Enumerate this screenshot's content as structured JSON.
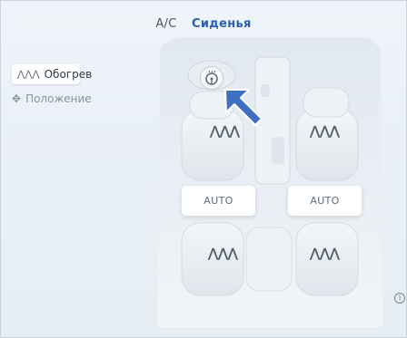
{
  "tabs": {
    "ac": "A/C",
    "seats": "Сиденья"
  },
  "menu": {
    "heating": "Обогрев",
    "position": "Положение"
  },
  "seats": {
    "front_left_heat_icon": "ꔷ",
    "auto_left": "AUTO",
    "auto_right": "AUTO"
  },
  "icons": {
    "heat": "heat-waves-icon",
    "position": "move-arrows-icon",
    "wheel": "heated-steering-wheel-icon",
    "info": "info-icon"
  },
  "colors": {
    "accent": "#2a5fb4",
    "arrow": "#3f6fc0",
    "background": "#e9f0f6"
  }
}
